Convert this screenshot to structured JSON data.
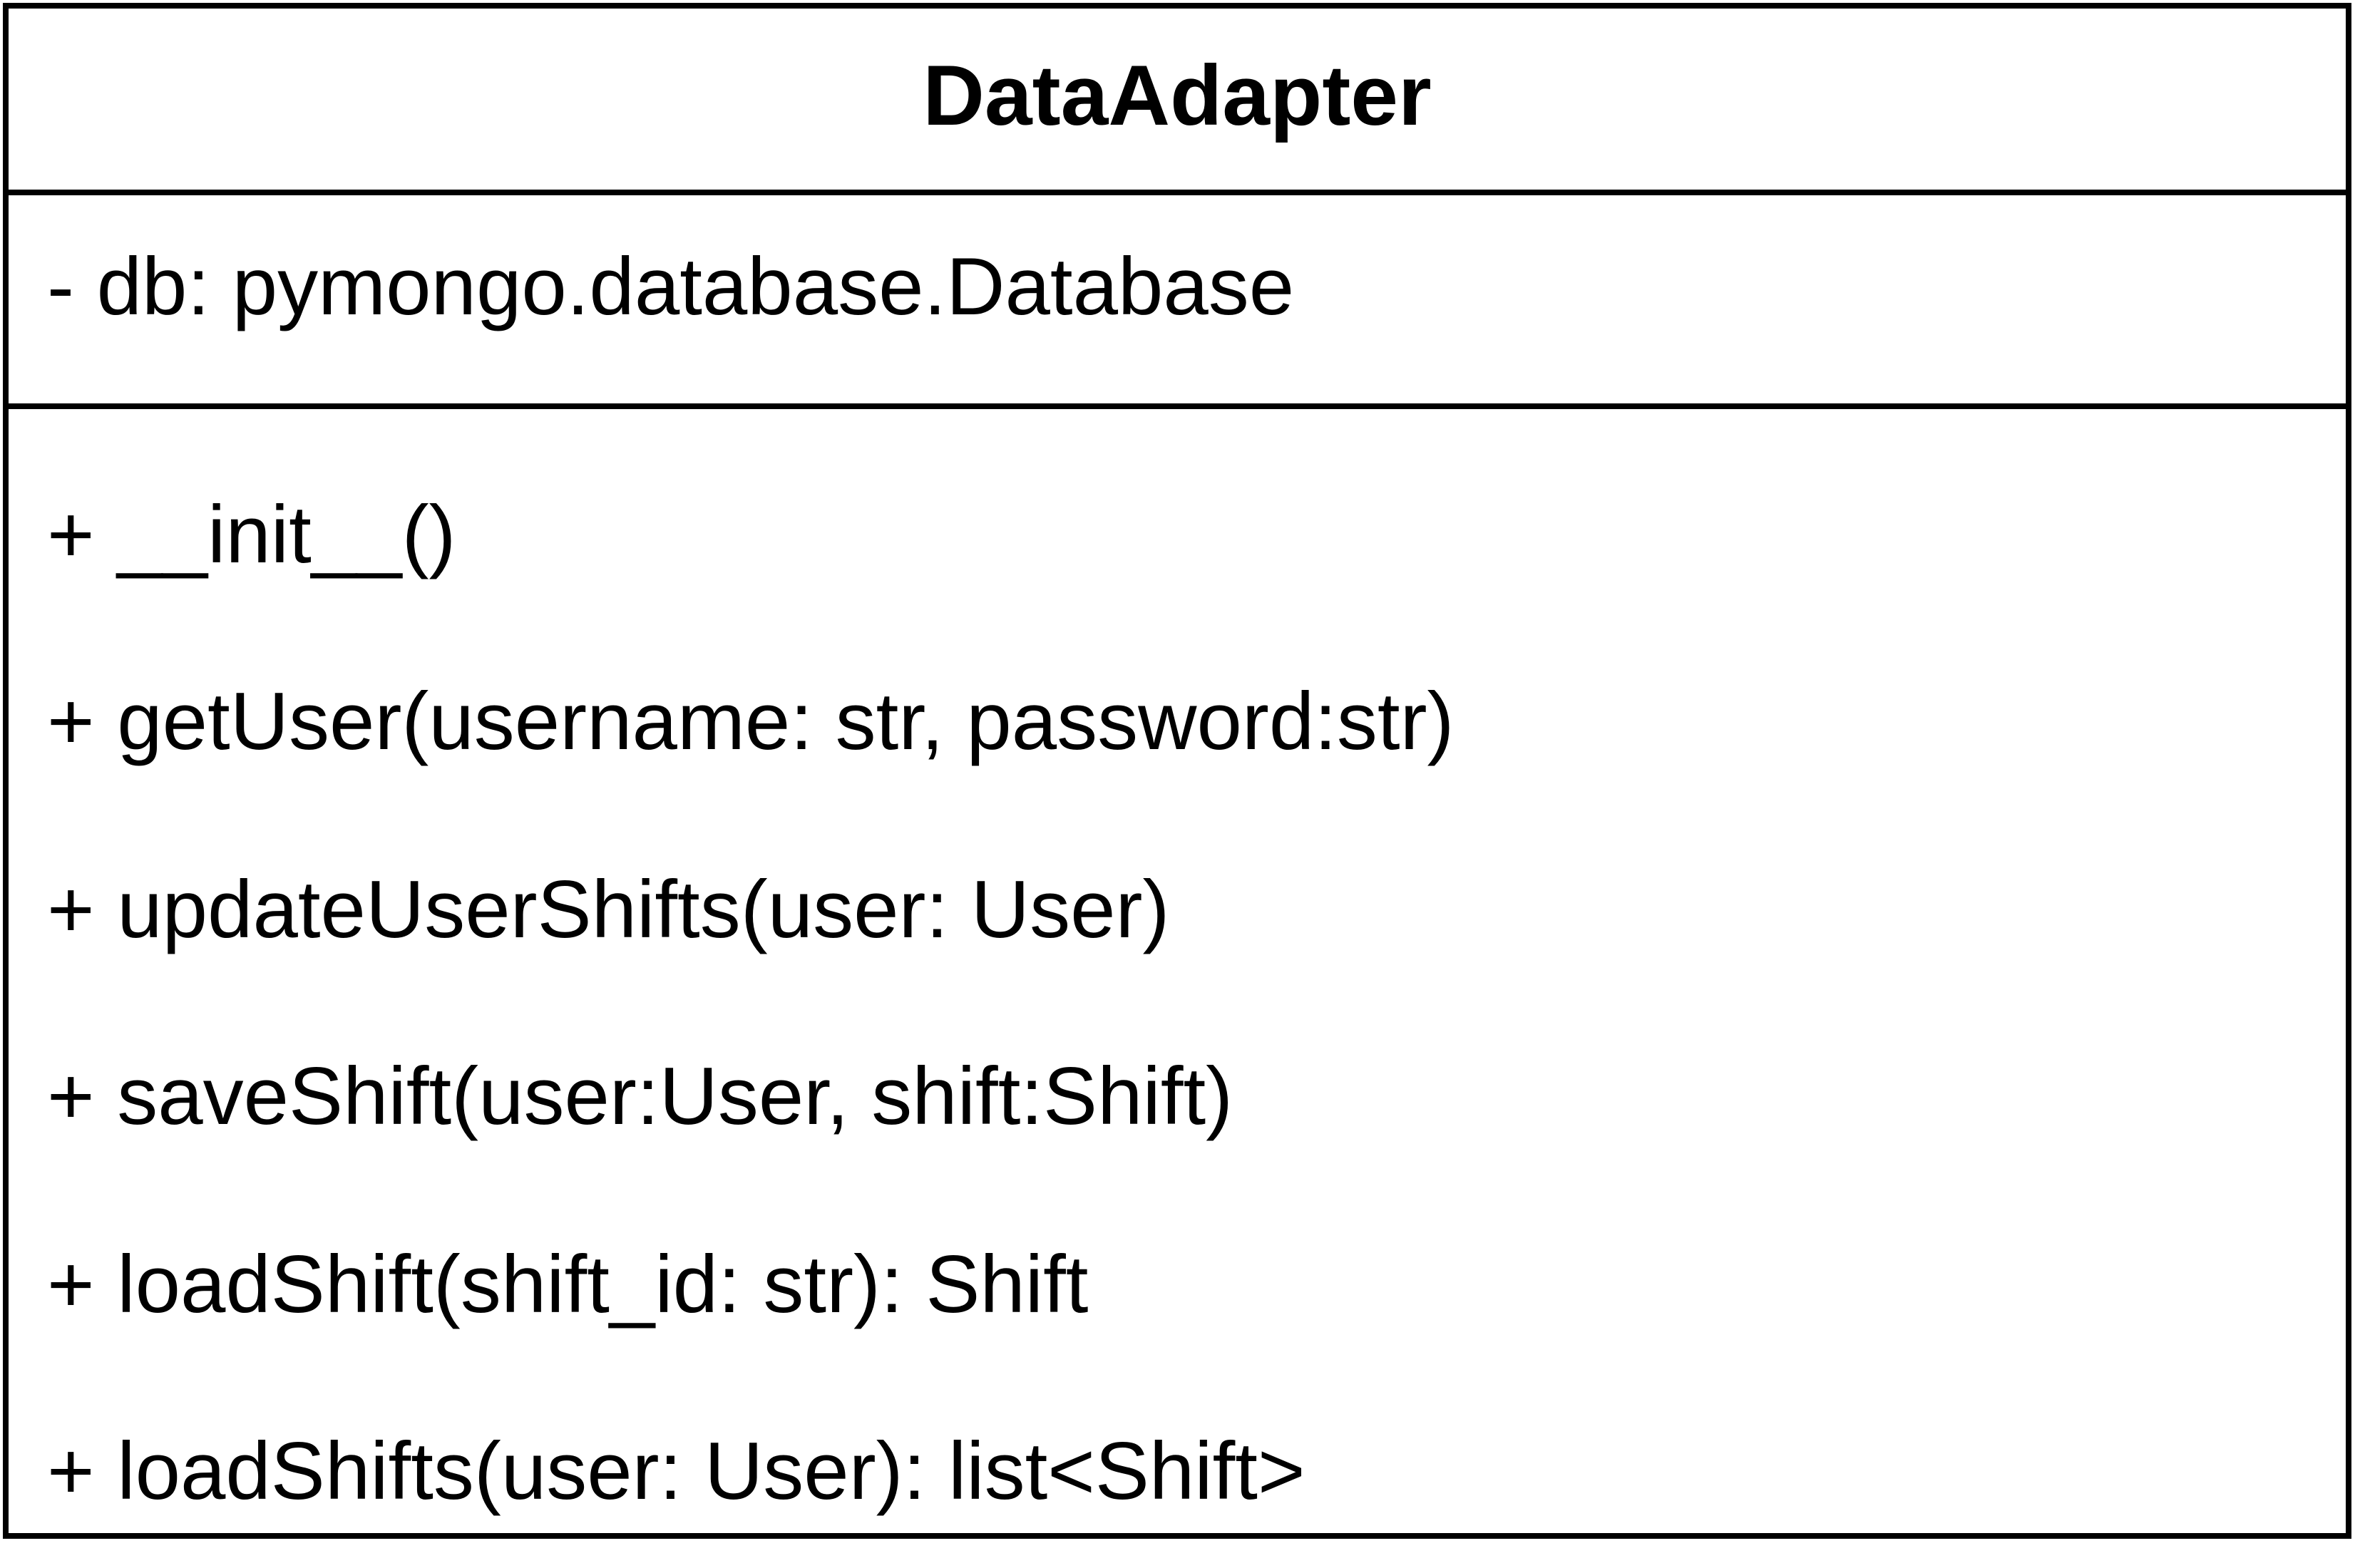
{
  "class": {
    "name": "DataAdapter",
    "attributes": [
      "- db: pymongo.database.Database"
    ],
    "methods": [
      "+ __init__()",
      "+ getUser(username: str, password:str)",
      "+ updateUserShifts(user: User)",
      "+ saveShift(user:User, shift:Shift)",
      "+ loadShift(shift_id: str): Shift",
      "+ loadShifts(user: User): list<Shift>"
    ]
  },
  "colors": {
    "border": "#000000",
    "background": "#ffffff",
    "text": "#000000"
  }
}
